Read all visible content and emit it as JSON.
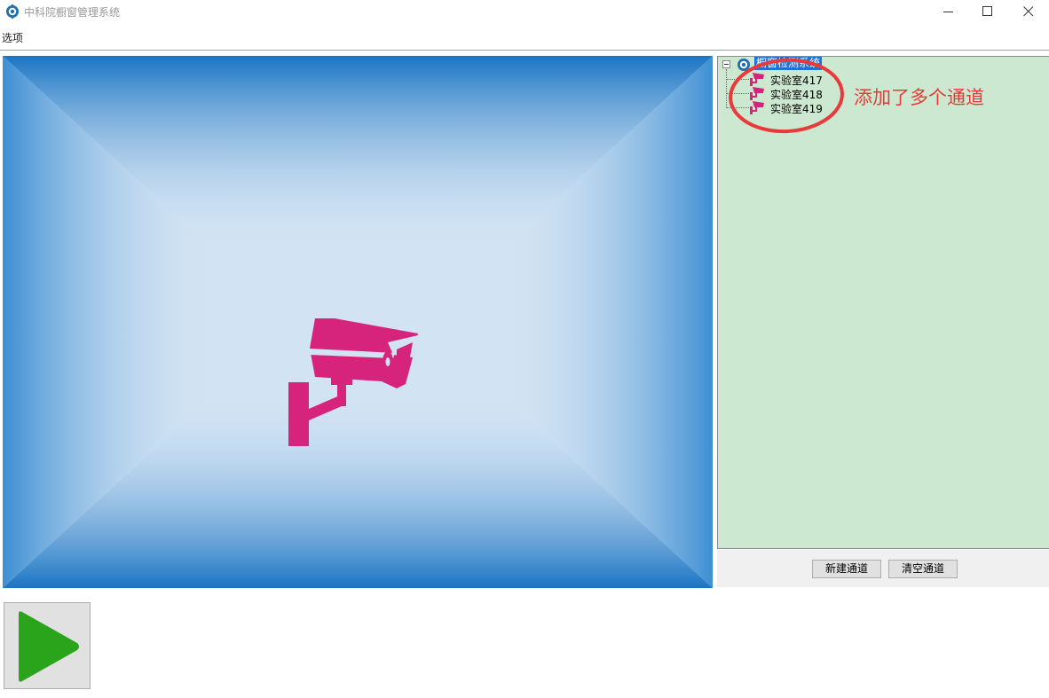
{
  "window": {
    "title": "中科院橱窗管理系统",
    "app_icon": "gear-logo-icon",
    "controls": [
      "minimize-icon",
      "maximize-icon",
      "close-icon"
    ]
  },
  "menu": {
    "items": [
      {
        "label": "选项"
      }
    ]
  },
  "video": {
    "placeholder_icon": "security-camera-icon",
    "icon_color": "#d6247c"
  },
  "tree": {
    "root": {
      "label": "橱窗检测系统",
      "icon": "gear-logo-icon",
      "selected": true,
      "expanded": true
    },
    "children": [
      {
        "label": "实验室417",
        "icon": "camera-icon"
      },
      {
        "label": "实验室418",
        "icon": "camera-icon"
      },
      {
        "label": "实验室419",
        "icon": "camera-icon"
      }
    ],
    "background_color": "#cde8d0"
  },
  "annotation": {
    "text": "添加了多个通道",
    "color": "#e83a3a"
  },
  "buttons": {
    "new_channel": "新建通道",
    "clear_channels": "清空通道"
  },
  "play_button": {
    "icon": "play-icon",
    "color": "#2aa41a"
  }
}
